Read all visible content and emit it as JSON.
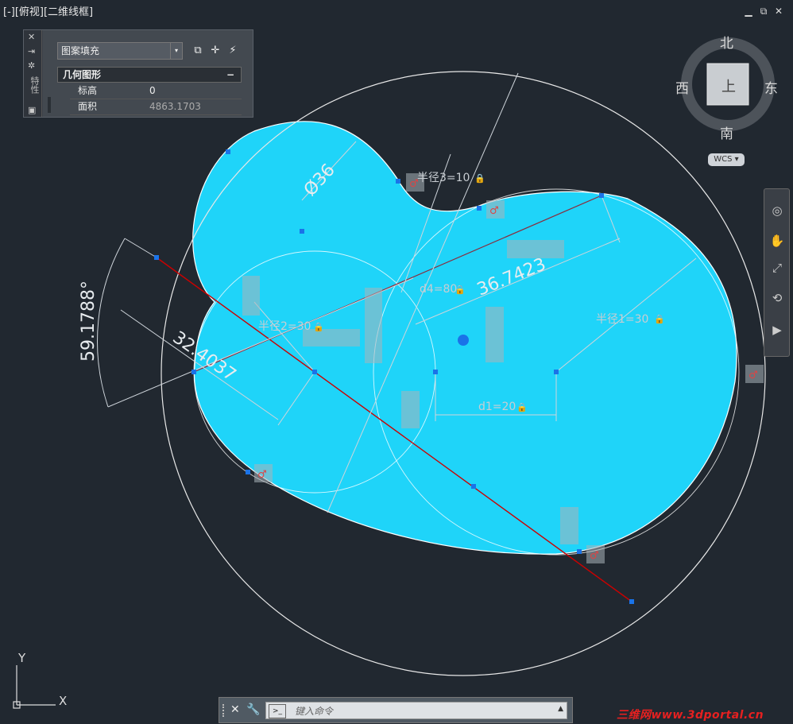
{
  "viewport_label": "[-][俯视][二维线框]",
  "window_controls": {
    "minimize": "▁",
    "restore": "⧉",
    "close": "✕"
  },
  "properties_palette": {
    "side_title": "特性",
    "object_type": "图案填充",
    "section_title": "几何图形",
    "collapse_symbol": "−",
    "rows": [
      {
        "key": "标高",
        "value": "0"
      },
      {
        "key": "面积",
        "value": "4863.1703"
      }
    ]
  },
  "viewcube": {
    "north": "北",
    "south": "南",
    "east": "东",
    "west": "西",
    "face": "上",
    "wcs": "WCS"
  },
  "drawing": {
    "colors": {
      "hatch": "#1fd4f9",
      "background": "#212830",
      "constraint_line": "#cc0000",
      "dimension": "#cfd5db",
      "geometry": "#ffffff"
    },
    "dimensions": {
      "diameter": "Ø36",
      "aligned_1": "36.7423",
      "aligned_2": "32.4037",
      "angle": "59.1788°",
      "radius_1": "半径1=30",
      "radius_2": "半径2=30",
      "radius_3": "半径3=10",
      "d1": "d1=20",
      "d4": "d4=80"
    }
  },
  "command_line": {
    "placeholder": "键入命令",
    "prompt_icon": ">_",
    "close_icon": "✕",
    "settings_icon": "🔧"
  },
  "ucs": {
    "x": "X",
    "y": "Y"
  },
  "watermark": "三维网www.3dportal.cn"
}
